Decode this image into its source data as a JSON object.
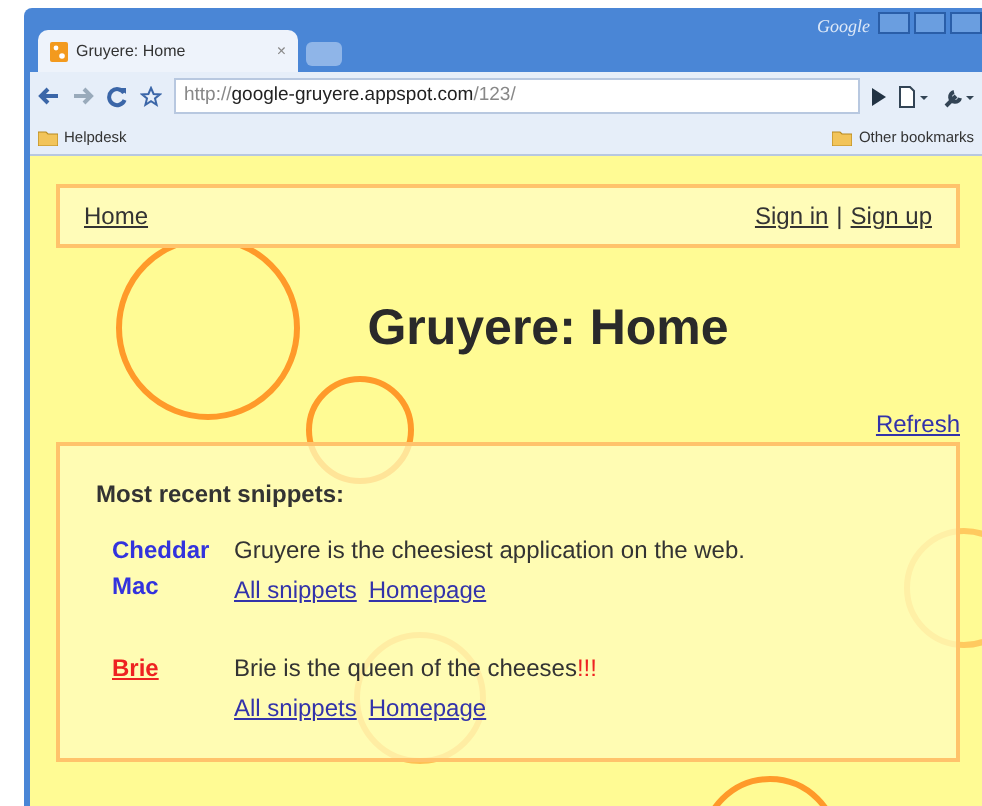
{
  "window": {
    "brand": "Google",
    "tab_title": "Gruyere: Home",
    "tab_close": "×"
  },
  "toolbar": {
    "url_scheme": "http://",
    "url_host": "google-gruyere.appspot.com",
    "url_path": "/123/"
  },
  "bookmarks": [
    "Helpdesk",
    "Other bookmarks"
  ],
  "menu": {
    "home": "Home",
    "sign_in": "Sign in",
    "separator": "|",
    "sign_up": "Sign up"
  },
  "title": "Gruyere: Home",
  "refresh": "Refresh",
  "snippets_heading": "Most recent snippets:",
  "snippets": [
    {
      "author": "Cheddar Mac",
      "color": "#3333dd",
      "underlined": false,
      "text": "Gruyere is the cheesiest application on the web.",
      "links": [
        "All snippets",
        "Homepage"
      ]
    },
    {
      "author": "Brie",
      "color": "#ee2222",
      "underlined": true,
      "text": "Brie is the queen of the cheeses",
      "alert": "!!!",
      "links": [
        "All snippets",
        "Homepage"
      ]
    }
  ]
}
